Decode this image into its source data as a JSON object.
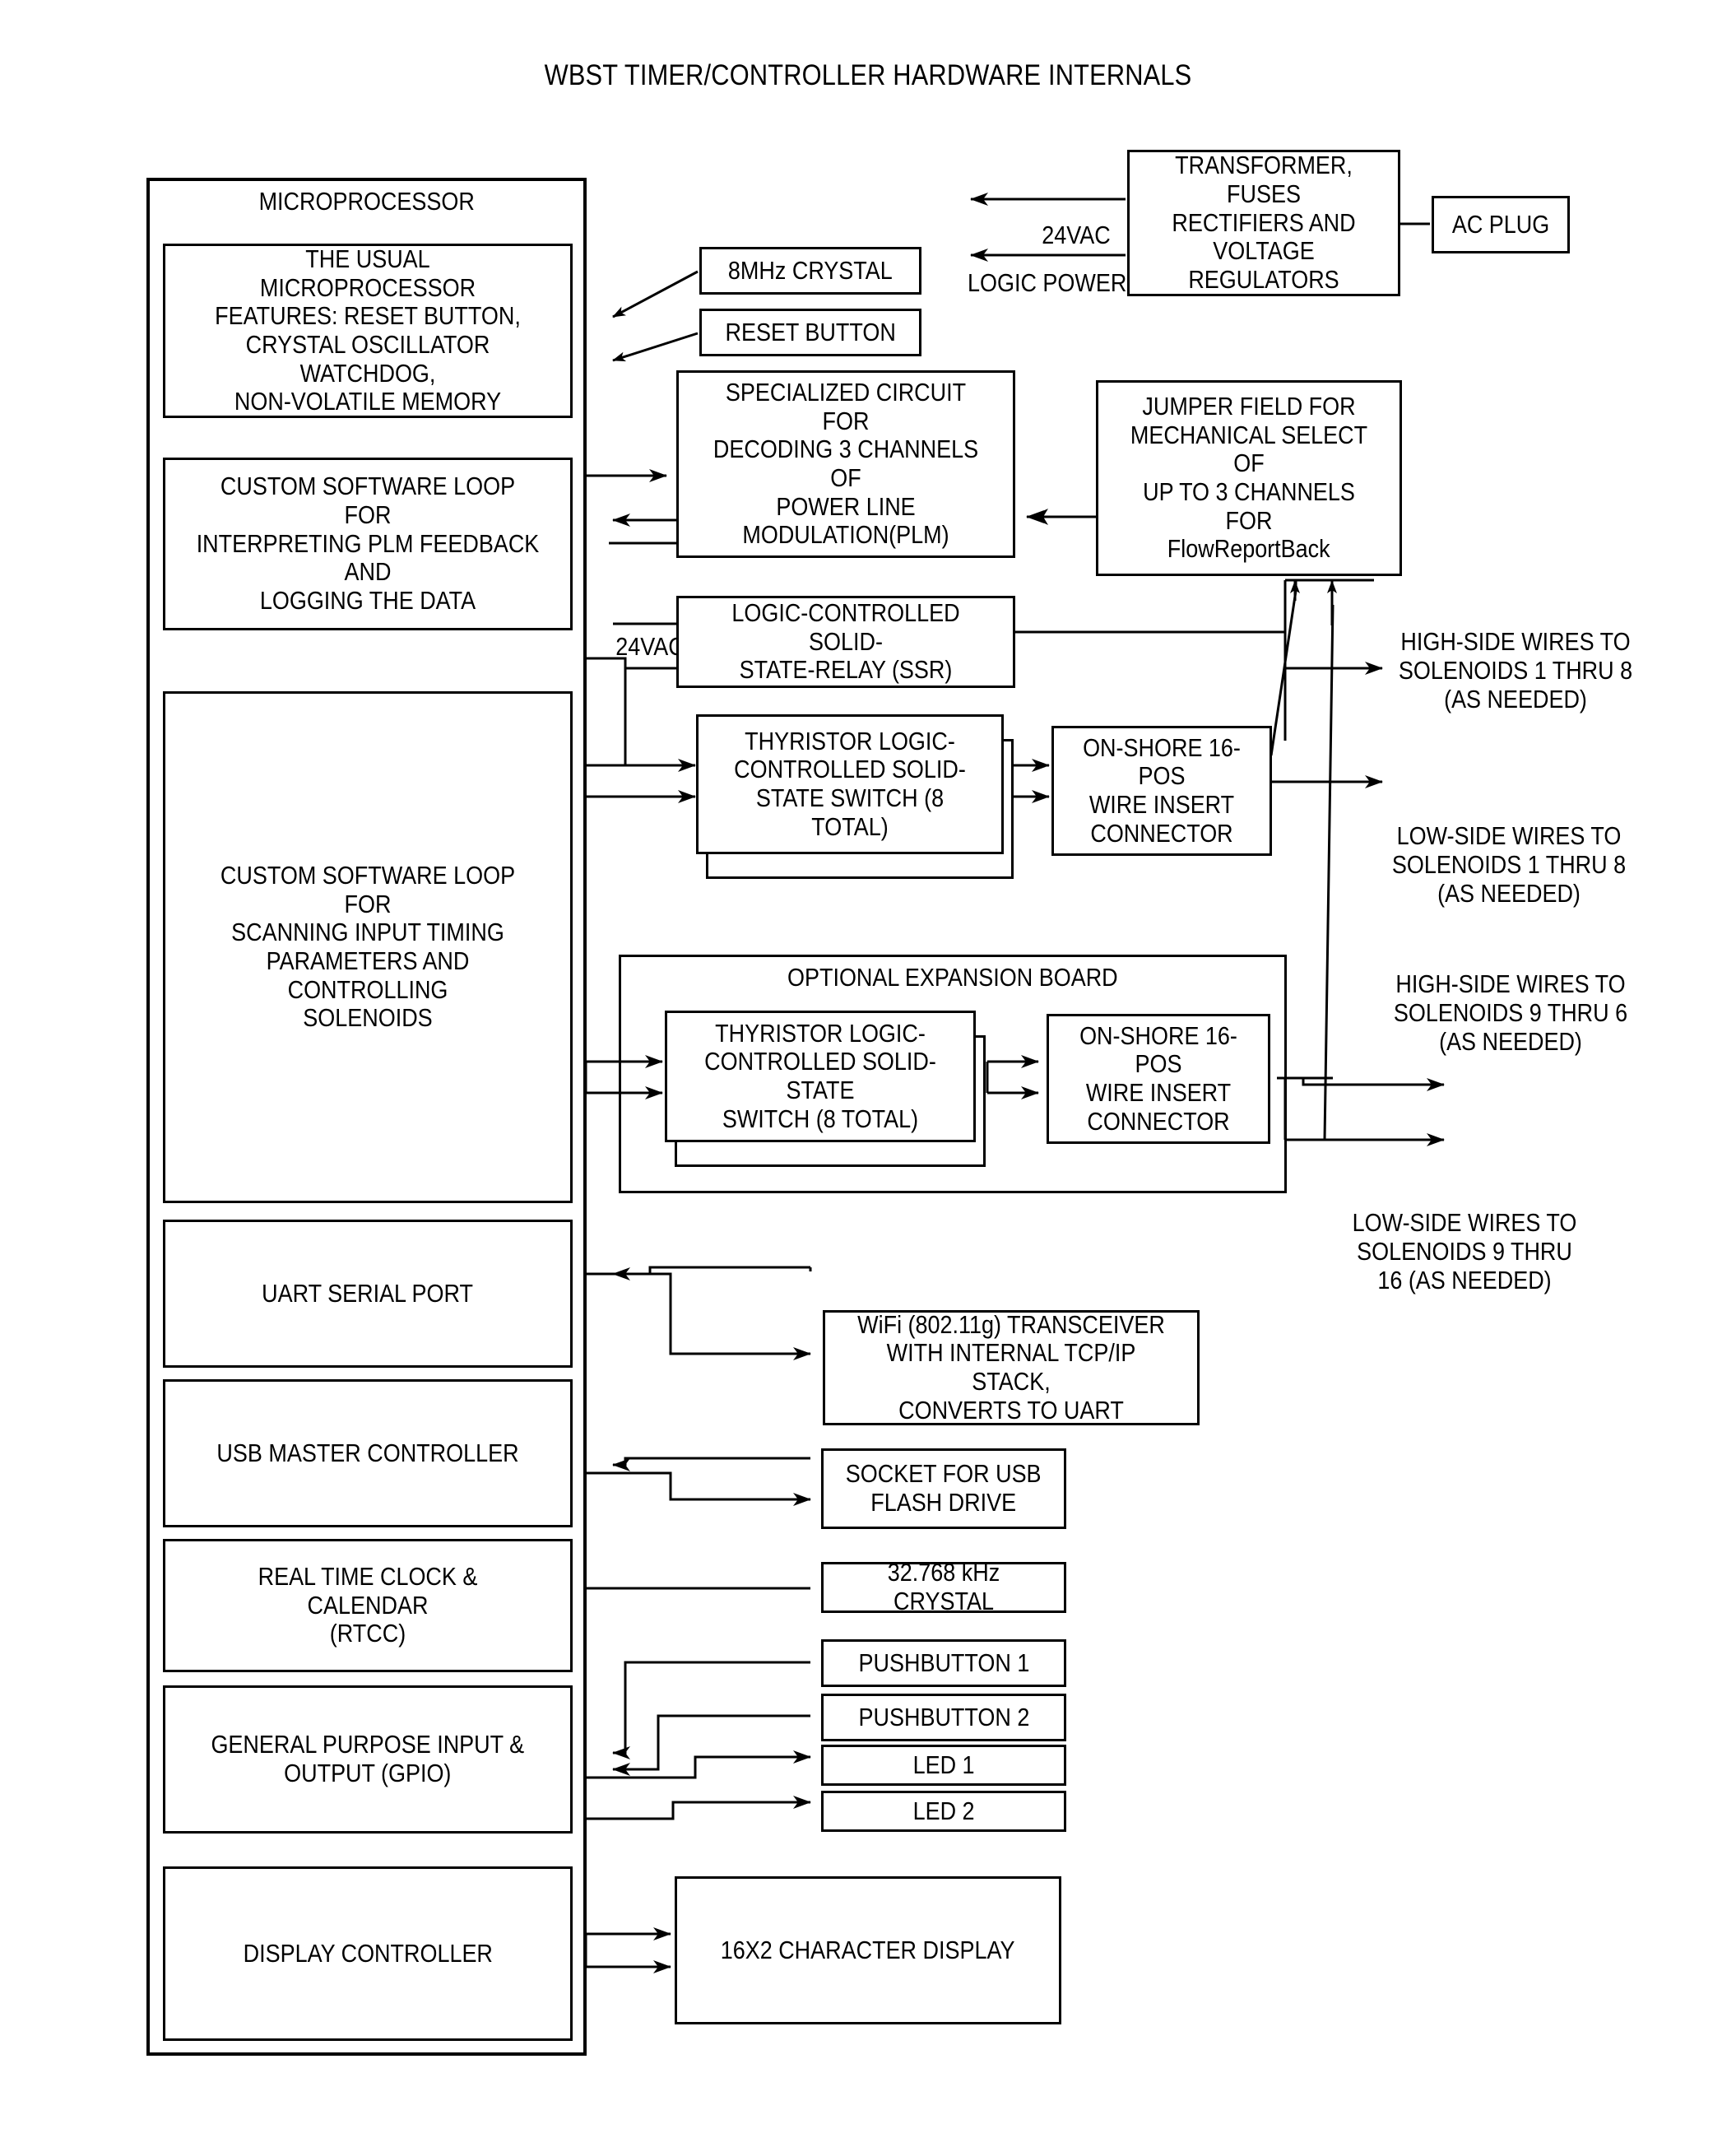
{
  "title": "WBST TIMER/CONTROLLER HARDWARE INTERNALS",
  "microprocessor": {
    "heading": "MICROPROCESSOR",
    "blocks": [
      {
        "id": "features",
        "lines": "THE USUAL MICROPROCESSOR\nFEATURES: RESET BUTTON,\nCRYSTAL OSCILLATOR WATCHDOG,\nNON-VOLATILE MEMORY"
      },
      {
        "id": "plm-loop",
        "lines": "CUSTOM SOFTWARE LOOP FOR\nINTERPRETING PLM FEEDBACK AND\nLOGGING THE DATA"
      },
      {
        "id": "scan-loop",
        "lines": "CUSTOM SOFTWARE LOOP FOR\nSCANNING INPUT TIMING\nPARAMETERS AND CONTROLLING\nSOLENOIDS"
      },
      {
        "id": "uart",
        "lines": "UART SERIAL PORT"
      },
      {
        "id": "usb",
        "lines": "USB MASTER CONTROLLER"
      },
      {
        "id": "rtcc",
        "lines": "REAL TIME CLOCK & CALENDAR\n(RTCC)"
      },
      {
        "id": "gpio",
        "lines": "GENERAL PURPOSE INPUT &\nOUTPUT (GPIO)"
      },
      {
        "id": "display-ctrl",
        "lines": "DISPLAY CONTROLLER"
      }
    ]
  },
  "power": {
    "supply": "TRANSFORMER, FUSES\nRECTIFIERS AND\nVOLTAGE REGULATORS",
    "plug": "AC PLUG",
    "arrow_24vac": "24VAC",
    "arrow_logic": "LOGIC POWER"
  },
  "clock": {
    "crystal_8mhz": "8MHz CRYSTAL",
    "reset_button": "RESET BUTTON"
  },
  "plm": {
    "decoder": "SPECIALIZED CIRCUIT FOR\nDECODING 3 CHANNELS OF\nPOWER LINE\nMODULATION(PLM)",
    "jumper_lines": "JUMPER FIELD FOR\nMECHANICAL SELECT OF\nUP TO 3 CHANNELS FOR",
    "jumper_mixed": "FlowReportBack"
  },
  "switching": {
    "label_24vac": "24VAC",
    "ssr": "LOGIC-CONTROLLED SOLID-\nSTATE-RELAY (SSR)",
    "thyristor_main": "THYRISTOR LOGIC-\nCONTROLLED SOLID-\nSTATE SWITCH (8 TOTAL)",
    "connector_main": "ON-SHORE 16-POS\nWIRE INSERT\nCONNECTOR",
    "expansion_heading": "OPTIONAL EXPANSION BOARD",
    "thyristor_exp": "THYRISTOR LOGIC-\nCONTROLLED SOLID-STATE\nSWITCH (8 TOTAL)",
    "connector_exp": "ON-SHORE 16-POS\nWIRE INSERT\nCONNECTOR"
  },
  "wire_labels": {
    "high_1_8": "HIGH-SIDE WIRES TO\nSOLENOIDS 1 THRU 8\n(AS NEEDED)",
    "low_1_8": "LOW-SIDE WIRES TO\nSOLENOIDS 1 THRU 8\n(AS NEEDED)",
    "high_9_16": "HIGH-SIDE WIRES TO\nSOLENOIDS 9 THRU 6\n(AS NEEDED)",
    "low_9_16": "LOW-SIDE WIRES TO\nSOLENOIDS 9 THRU\n16 (AS NEEDED)"
  },
  "peripherals": {
    "wifi": "WiFi (802.11g) TRANSCEIVER\nWITH INTERNAL TCP/IP STACK,\nCONVERTS TO UART",
    "usb_socket": "SOCKET FOR USB\nFLASH DRIVE",
    "crystal_32k": "32.768 kHz CRYSTAL",
    "pushbutton1": "PUSHBUTTON 1",
    "pushbutton2": "PUSHBUTTON 2",
    "led1": "LED 1",
    "led2": "LED 2",
    "display": "16X2 CHARACTER DISPLAY"
  },
  "colors": {
    "ink": "#000000",
    "paper": "#ffffff"
  }
}
